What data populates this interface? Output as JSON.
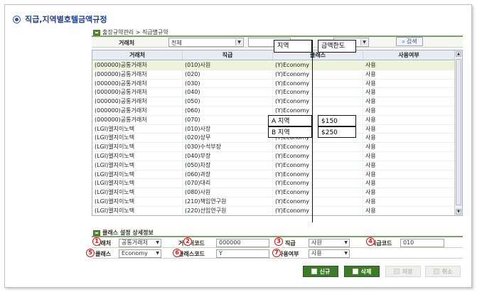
{
  "page": {
    "title": "직급,지역별호텔금액규정"
  },
  "breadcrumb": {
    "text": "출장규약관리 > 직급별규약"
  },
  "filter": {
    "label": "거래처",
    "customer_value": "전체",
    "second_value": "",
    "third_value": "",
    "search_label": "검색"
  },
  "callouts": {
    "region": "지역",
    "limit": "금액한도",
    "a_region": "A 지역",
    "b_region": "B 지역",
    "a_amount": "$150",
    "b_amount": "$250"
  },
  "grid": {
    "columns": [
      "거래처",
      "직급",
      "클래스",
      "사용여부"
    ],
    "rows": [
      [
        "(000000)공통거래처",
        "(010)사원",
        "(Y)Economy",
        "사용"
      ],
      [
        "(000000)공통거래처",
        "(020)",
        "(Y)Economy",
        "사용"
      ],
      [
        "(000000)공통거래처",
        "(030)",
        "(Y)Economy",
        "사용"
      ],
      [
        "(000000)공통거래처",
        "(040)",
        "(Y)Economy",
        "사용"
      ],
      [
        "(000000)공통거래처",
        "(050)",
        "(Y)Economy",
        "사용"
      ],
      [
        "(000000)공통거래처",
        "(060)",
        "(Y)Economy",
        "사용"
      ],
      [
        "(000000)공통거래처",
        "(070)",
        "(Y)Economy",
        "사용"
      ],
      [
        "(LGI)엘지이노텍",
        "(010)사장",
        "(Y)Economy",
        "사용"
      ],
      [
        "(LGI)엘지이노텍",
        "(020)상무",
        "(Y)Economy",
        "사용"
      ],
      [
        "(LGI)엘지이노텍",
        "(030)수석부장",
        "(Y)Economy",
        "사용"
      ],
      [
        "(LGI)엘지이노텍",
        "(040)부장",
        "(Y)Economy",
        "사용"
      ],
      [
        "(LGI)엘지이노텍",
        "(050)차장",
        "(Y)Economy",
        "사용"
      ],
      [
        "(LGI)엘지이노텍",
        "(060)과장",
        "(Y)Economy",
        "사용"
      ],
      [
        "(LGI)엘지이노텍",
        "(070)대리",
        "(Y)Economy",
        "사용"
      ],
      [
        "(LGI)엘지이노텍",
        "(080)사원",
        "(Y)Economy",
        "사용"
      ],
      [
        "(LGI)엘지이노텍",
        "(210)책임연구원",
        "(Y)Economy",
        "사용"
      ],
      [
        "(LGI)엘지이노텍",
        "(220)선임연구원",
        "(Y)Economy",
        "사용"
      ]
    ]
  },
  "detail": {
    "title": "클래스 설정 상세정보",
    "customer_label": "거래처",
    "customer_value": "공통거래처",
    "customer_code_label": "거래처코드",
    "customer_code_value": "000000",
    "rank_label": "직급",
    "rank_value": "사원",
    "rank_code_label": "직급코드",
    "rank_code_value": "010",
    "class_label": "클래스",
    "class_value": "Economy",
    "class_code_label": "클래스코드",
    "class_code_value": "Y",
    "usage_label": "사용여부",
    "usage_value": "사용",
    "markers": [
      "1",
      "2",
      "3",
      "4",
      "5",
      "6",
      "7"
    ]
  },
  "buttons": {
    "new": "신규",
    "delete": "삭제",
    "save": "저장",
    "cancel": "취소"
  },
  "colors": {
    "accent_green": "#3e7a2a",
    "title_blue": "#1f3f8f",
    "marker_red": "#dd1111"
  }
}
